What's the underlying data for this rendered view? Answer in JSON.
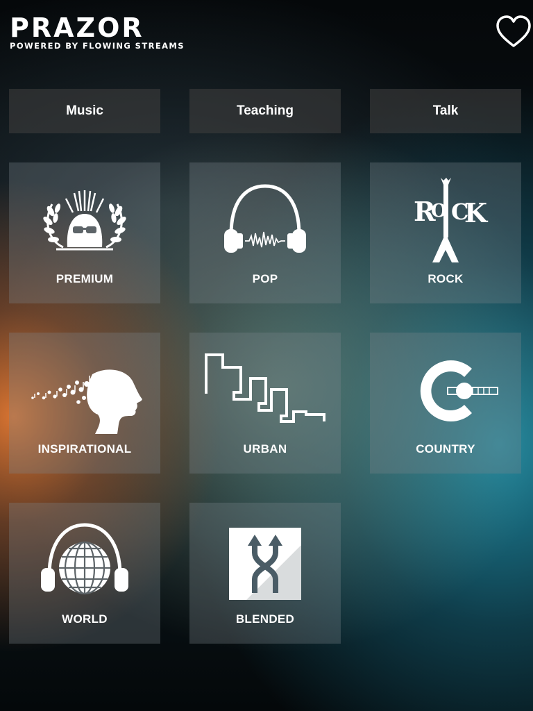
{
  "app": {
    "logo_text": "PRAZOR",
    "tagline": "POWERED BY FLOWING STREAMS",
    "favorite_icon": "heart-outline-icon"
  },
  "tabs": [
    {
      "label": "Music"
    },
    {
      "label": "Teaching"
    },
    {
      "label": "Talk"
    }
  ],
  "genres": [
    {
      "label": "PREMIUM",
      "icon": "premium-crown-icon"
    },
    {
      "label": "POP",
      "icon": "headphones-icon"
    },
    {
      "label": "ROCK",
      "icon": "rock-guitar-icon"
    },
    {
      "label": "INSPIRATIONAL",
      "icon": "head-music-notes-icon"
    },
    {
      "label": "URBAN",
      "icon": "urban-skyline-icon"
    },
    {
      "label": "COUNTRY",
      "icon": "country-guitar-icon"
    },
    {
      "label": "WORLD",
      "icon": "world-headphones-icon"
    },
    {
      "label": "BLENDED",
      "icon": "blended-arrows-icon"
    }
  ]
}
